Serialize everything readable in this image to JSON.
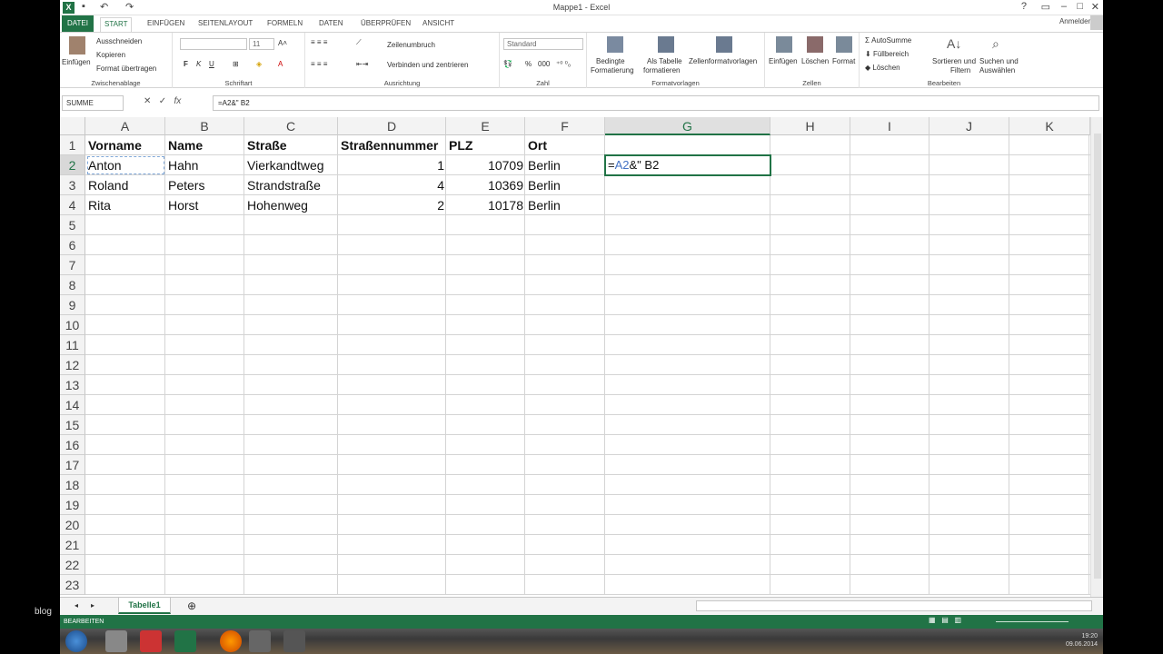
{
  "window": {
    "title": "Mappe1 - Excel",
    "signin": "Anmelden"
  },
  "tabs": [
    "DATEI",
    "START",
    "EINFÜGEN",
    "SEITENLAYOUT",
    "FORMELN",
    "DATEN",
    "ÜBERPRÜFEN",
    "ANSICHT"
  ],
  "ribbon": {
    "clipboard": {
      "paste": "Einfügen",
      "cut": "Ausschneiden",
      "copy": "Kopieren",
      "painter": "Format übertragen",
      "label": "Zwischenablage"
    },
    "font": {
      "size": "11",
      "label": "Schriftart",
      "bold": "F",
      "italic": "K",
      "underline": "U"
    },
    "alignment": {
      "wrap": "Zeilenumbruch",
      "merge": "Verbinden und zentrieren",
      "label": "Ausrichtung"
    },
    "number": {
      "format": "Standard",
      "label": "Zahl",
      "percent": "%",
      "thousands": "000"
    },
    "styles": {
      "cond1": "Bedingte",
      "cond2": "Formatierung",
      "table1": "Als Tabelle",
      "table2": "formatieren",
      "cellstyles": "Zellenformatvorlagen",
      "label": "Formatvorlagen"
    },
    "cells": {
      "insert": "Einfügen",
      "delete": "Löschen",
      "format": "Format",
      "label": "Zellen"
    },
    "editing": {
      "autosum": "AutoSumme",
      "fill": "Füllbereich",
      "clear": "Löschen",
      "sort1": "Sortieren und",
      "sort2": "Filtern",
      "find1": "Suchen und",
      "find2": "Auswählen",
      "label": "Bearbeiten"
    }
  },
  "formula_bar": {
    "name_box": "SUMME",
    "formula": "=A2&\" B2"
  },
  "columns": [
    "A",
    "B",
    "C",
    "D",
    "E",
    "F",
    "G",
    "H",
    "I",
    "J",
    "K"
  ],
  "rows": [
    "1",
    "2",
    "3",
    "4",
    "5",
    "6",
    "7",
    "8",
    "9",
    "10",
    "11",
    "12",
    "13",
    "14",
    "15",
    "16",
    "17",
    "18",
    "19",
    "20",
    "21",
    "22",
    "23"
  ],
  "cells": {
    "r1": [
      "Vorname",
      "Name",
      "Straße",
      "Straßennummer",
      "PLZ",
      "Ort"
    ],
    "r2": [
      "Anton",
      "Hahn",
      "Vierkandtweg",
      "1",
      "10709",
      "Berlin"
    ],
    "r3": [
      "Roland",
      "Peters",
      "Strandstraße",
      "4",
      "10369",
      "Berlin"
    ],
    "r4": [
      "Rita",
      "Horst",
      "Hohenweg",
      "2",
      "10178",
      "Berlin"
    ]
  },
  "active_cell": {
    "ref_part": "A2",
    "rest": "&\" B2"
  },
  "sheet": {
    "name": "Tabelle1"
  },
  "status": {
    "mode": "BEARBEITEN"
  },
  "taskbar": {
    "time": "19:20",
    "date": "09.06.2014"
  },
  "overlay": {
    "blog": "blog"
  },
  "colors": {
    "excel_green": "#217346",
    "ref_blue": "#4472c4"
  }
}
